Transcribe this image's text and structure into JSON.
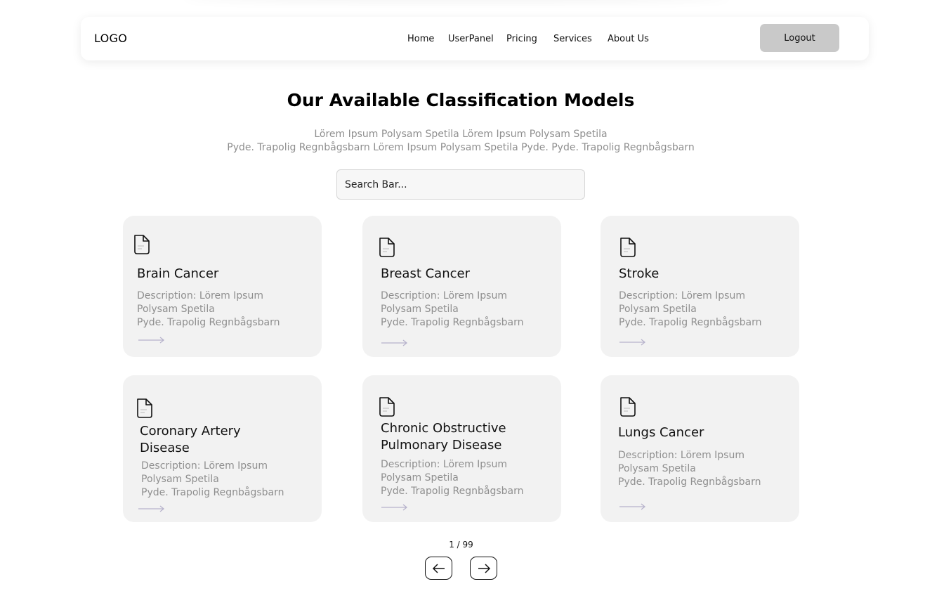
{
  "header": {
    "logo": "LOGO",
    "nav": [
      "Home",
      "UserPanel",
      "Pricing",
      "Services",
      "About Us"
    ],
    "logout_label": "Logout"
  },
  "main": {
    "title": "Our Available Classification Models",
    "subtitle_line1": "Lörem Ipsum Polysam Spetila  Lörem Ipsum Polysam Spetila",
    "subtitle_line2": "Pyde. Trapolig Regnbågsbarn Lörem Ipsum Polysam Spetila Pyde. Pyde. Trapolig Regnbågsbarn",
    "search_placeholder": "Search Bar..."
  },
  "cards": [
    {
      "title": "Brain Cancer",
      "desc": [
        "Description: Lörem Ipsum",
        "Polysam Spetila",
        "Pyde. Trapolig Regnbågsbarn"
      ],
      "icon": "document-icon"
    },
    {
      "title": "Breast Cancer",
      "desc": [
        "Description: Lörem Ipsum",
        "Polysam Spetila",
        "Pyde. Trapolig Regnbågsbarn"
      ],
      "icon": "document-icon"
    },
    {
      "title": "Stroke",
      "desc": [
        "Description: Lörem Ipsum",
        "Polysam Spetila",
        "Pyde. Trapolig Regnbågsbarn"
      ],
      "icon": "document-icon"
    },
    {
      "title": "Coronary Artery Disease",
      "desc": [
        "Description: Lörem Ipsum",
        "Polysam Spetila",
        "Pyde. Trapolig Regnbågsbarn"
      ],
      "icon": "document-icon"
    },
    {
      "title": "Chronic Obstructive Pulmonary Disease",
      "desc": [
        "Description: Lörem Ipsum",
        "Polysam Spetila",
        "Pyde. Trapolig Regnbågsbarn"
      ],
      "icon": "document-icon"
    },
    {
      "title": "Lungs Cancer",
      "desc": [
        "Description: Lörem Ipsum",
        "Polysam Spetila",
        "Pyde. Trapolig Regnbågsbarn"
      ],
      "icon": "document-icon"
    }
  ],
  "pagination": {
    "label": "1 / 99",
    "prev_icon": "arrow-left-icon",
    "next_icon": "arrow-right-icon"
  },
  "colors": {
    "card_bg": "#f2f2f2",
    "muted_text": "#8f8f8f",
    "logout_bg": "#c9c9c9",
    "arrow": "#b7b3cc"
  }
}
